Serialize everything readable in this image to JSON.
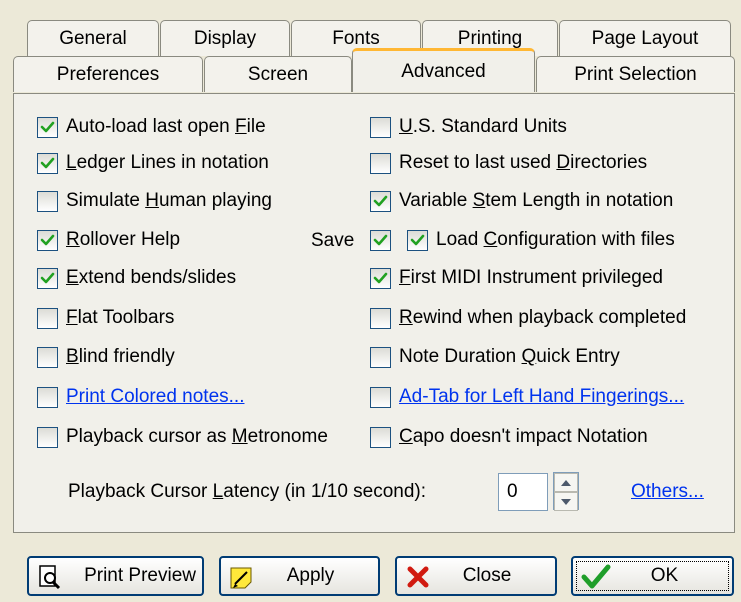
{
  "tabs_row1": [
    {
      "label": "General"
    },
    {
      "label": "Display"
    },
    {
      "label": "Fonts"
    },
    {
      "label": "Printing"
    },
    {
      "label": "Page Layout"
    }
  ],
  "tabs_row2": [
    {
      "label": "Preferences"
    },
    {
      "label": "Screen"
    },
    {
      "label": "Advanced",
      "active": true
    },
    {
      "label": "Print Selection"
    }
  ],
  "left_options": [
    {
      "pre": "Auto-load last open ",
      "u": "F",
      "post": "ile",
      "checked": true
    },
    {
      "pre": "",
      "u": "L",
      "post": "edger Lines in notation",
      "checked": true
    },
    {
      "pre": "Simulate ",
      "u": "H",
      "post": "uman playing",
      "checked": false
    },
    {
      "pre": "",
      "u": "R",
      "post": "ollover Help",
      "checked": true
    },
    {
      "pre": "",
      "u": "E",
      "post": "xtend bends/slides",
      "checked": true
    },
    {
      "pre": "",
      "u": "F",
      "post": "lat Toolbars",
      "checked": false
    },
    {
      "pre": "",
      "u": "B",
      "post": "lind friendly",
      "checked": false
    },
    {
      "pre": "Print Colored notes...",
      "u": "",
      "post": "",
      "checked": false,
      "link": true
    },
    {
      "pre": "Playback cursor as ",
      "u": "M",
      "post": "etronome",
      "checked": false
    }
  ],
  "right_options": [
    {
      "pre": "",
      "u": "U",
      "post": ".S. Standard Units",
      "checked": false
    },
    {
      "pre": "Reset to last used ",
      "u": "D",
      "post": "irectories",
      "checked": false
    },
    {
      "pre": "Variable ",
      "u": "S",
      "post": "tem Length in notation",
      "checked": true
    },
    {
      "pre": "Load ",
      "u": "C",
      "post": "onfiguration with files",
      "checked": true
    },
    {
      "pre": "",
      "u": "F",
      "post": "irst MIDI Instrument privileged",
      "checked": true
    },
    {
      "pre": "",
      "u": "R",
      "post": "ewind when playback completed",
      "checked": false
    },
    {
      "pre": "Note Duration ",
      "u": "Q",
      "post": "uick Entry",
      "checked": false
    },
    {
      "pre": "Ad-Tab for Left Hand Fingerings...",
      "u": "",
      "post": "",
      "checked": false,
      "link": true
    },
    {
      "pre": "",
      "u": "C",
      "post": "apo doesn't impact Notation",
      "checked": false
    }
  ],
  "save": {
    "label": "Save",
    "checked": true
  },
  "latency": {
    "pre": "Playback Cursor ",
    "u": "L",
    "post": "atency (in 1/10 second):",
    "value": "0"
  },
  "others_link": "Others...",
  "buttons": {
    "print_preview": "Print Preview",
    "apply": "Apply",
    "close": "Close",
    "ok": "OK"
  },
  "colors": {
    "accent_tab": "#ffb733",
    "check": "#21a121",
    "link": "#0033ee",
    "background": "#ece9d8"
  }
}
